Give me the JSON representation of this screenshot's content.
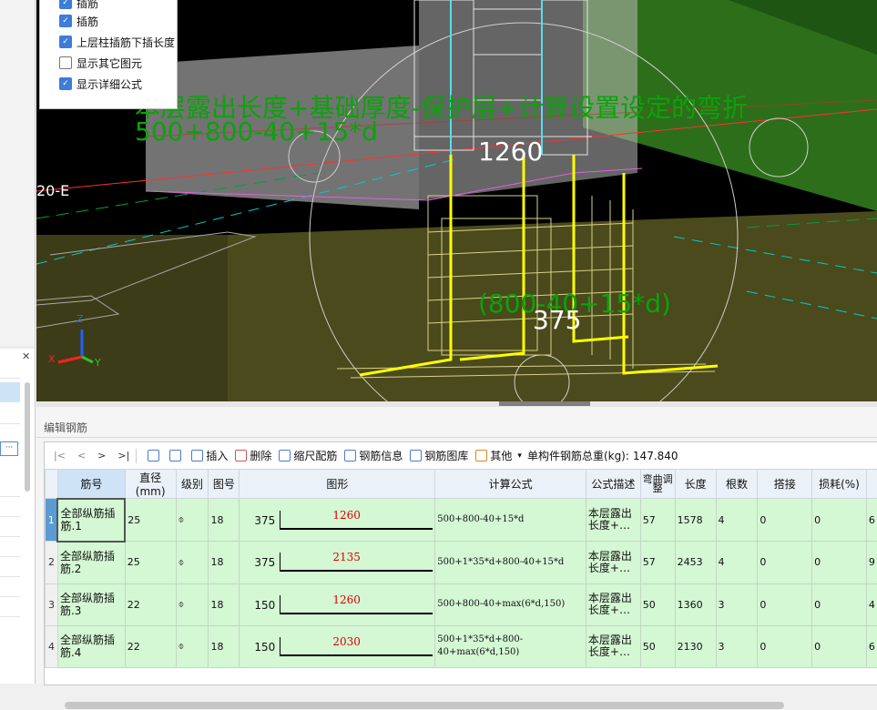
{
  "viewport": {
    "options": [
      {
        "label": "插筋",
        "checked": true
      },
      {
        "label": "插筋",
        "checked": true
      },
      {
        "label": "上层柱插筋下插长度",
        "checked": true
      },
      {
        "label": "显示其它图元",
        "checked": false
      },
      {
        "label": "显示详细公式",
        "checked": true
      }
    ],
    "formula_text_1": "本层露出长度+基础厚度-保护层+计算设置设定的弯折",
    "formula_text_2": "500+800-40+15*d",
    "dim_1": "1260",
    "dim_2": "375",
    "formula_text_3": "(800-40+15*d)",
    "axis_label": "20-E",
    "axis_z": "Z",
    "axis_x": "X",
    "axis_y": "Y",
    "colors": {
      "formula": "#0aa30a",
      "bar": "#ffff00",
      "concrete": "#4a4a1c",
      "wall": "#2d6e1a"
    }
  },
  "editor": {
    "title": "编辑钢筋",
    "nav": [
      "|<",
      "<",
      ">",
      ">|"
    ],
    "toolbar": {
      "insert": "插入",
      "delete": "删除",
      "scale": "缩尺配筋",
      "info": "钢筋信息",
      "library": "钢筋图库",
      "other": "其他",
      "total_label": "单构件钢筋总重(kg):",
      "total_value": "147.840"
    },
    "columns": {
      "name": "筋号",
      "diameter": "直径(mm)",
      "grade": "级别",
      "figno": "图号",
      "shape": "图形",
      "formula": "计算公式",
      "desc": "公式描述",
      "bend": "弯曲调整",
      "length": "长度",
      "count": "根数",
      "lap": "搭接",
      "loss": "损耗(%)"
    },
    "rows": [
      {
        "no": "1",
        "name": "全部纵筋插筋.1",
        "diameter": "25",
        "grade": "⌽",
        "figno": "18",
        "left": "375",
        "value": "1260",
        "formula": "500+800-40+15*d",
        "desc": "本层露出长度+…",
        "bend": "57",
        "length": "1578",
        "count": "4",
        "lap": "0",
        "loss": "0",
        "extra": "6"
      },
      {
        "no": "2",
        "name": "全部纵筋插筋.2",
        "diameter": "25",
        "grade": "⌽",
        "figno": "18",
        "left": "375",
        "value": "2135",
        "formula": "500+1*35*d+800-40+15*d",
        "desc": "本层露出长度+…",
        "bend": "57",
        "length": "2453",
        "count": "4",
        "lap": "0",
        "loss": "0",
        "extra": "9"
      },
      {
        "no": "3",
        "name": "全部纵筋插筋.3",
        "diameter": "22",
        "grade": "⌽",
        "figno": "18",
        "left": "150",
        "value": "1260",
        "formula": "500+800-40+max(6*d,150)",
        "desc": "本层露出长度+…",
        "bend": "50",
        "length": "1360",
        "count": "3",
        "lap": "0",
        "loss": "0",
        "extra": "4"
      },
      {
        "no": "4",
        "name": "全部纵筋插筋.4",
        "diameter": "22",
        "grade": "⌽",
        "figno": "18",
        "left": "150",
        "value": "2030",
        "formula": "500+1*35*d+800-40+max(6*d,150)",
        "desc": "本层露出长度+…",
        "bend": "50",
        "length": "2130",
        "count": "3",
        "lap": "0",
        "loss": "0",
        "extra": "6"
      }
    ]
  }
}
